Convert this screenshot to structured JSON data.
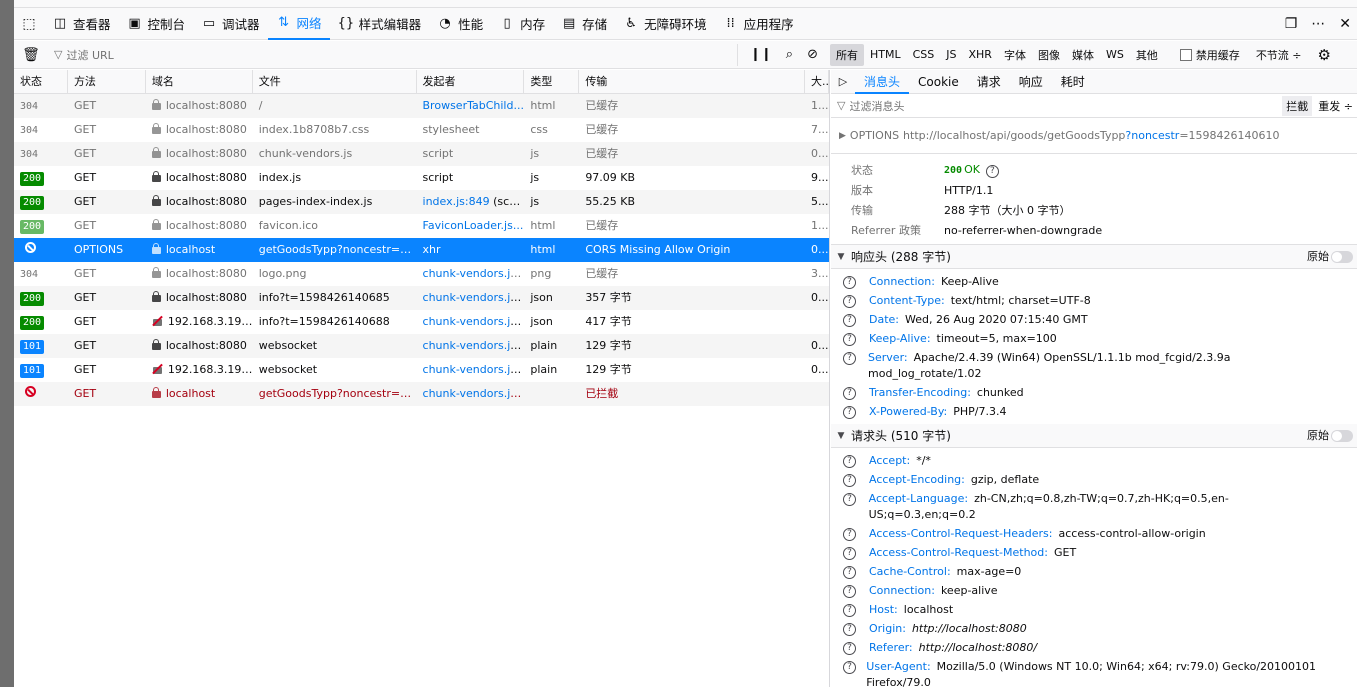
{
  "toolbar": {
    "tabs": [
      {
        "label": "查看器",
        "icon": "inspector-icon"
      },
      {
        "label": "控制台",
        "icon": "console-icon"
      },
      {
        "label": "调试器",
        "icon": "debugger-icon"
      },
      {
        "label": "网络",
        "icon": "network-icon"
      },
      {
        "label": "样式编辑器",
        "icon": "style-editor-icon"
      },
      {
        "label": "性能",
        "icon": "performance-icon"
      },
      {
        "label": "内存",
        "icon": "memory-icon"
      },
      {
        "label": "存储",
        "icon": "storage-icon"
      },
      {
        "label": "无障碍环境",
        "icon": "accessibility-icon"
      },
      {
        "label": "应用程序",
        "icon": "application-icon"
      }
    ],
    "active_tab": "网络"
  },
  "filterbar": {
    "placeholder": "过滤 URL",
    "types": [
      "所有",
      "HTML",
      "CSS",
      "JS",
      "XHR",
      "字体",
      "图像",
      "媒体",
      "WS",
      "其他"
    ],
    "selected_type": "所有",
    "disable_cache_label": "禁用缓存",
    "throttle_label": "不节流 ÷"
  },
  "table": {
    "columns": [
      "状态",
      "方法",
      "域名",
      "文件",
      "发起者",
      "类型",
      "传输",
      "大..."
    ],
    "rows": [
      {
        "status": "304",
        "method": "GET",
        "domain": "localhost:8080",
        "lock": "secure",
        "file": "/",
        "initiator": "BrowserTabChild...",
        "initiator_link": true,
        "type": "html",
        "transferred": "已缓存",
        "size": "1...",
        "style": "cached"
      },
      {
        "status": "304",
        "method": "GET",
        "domain": "localhost:8080",
        "lock": "secure",
        "file": "index.1b8708b7.css",
        "initiator": "stylesheet",
        "initiator_link": false,
        "type": "css",
        "transferred": "已缓存",
        "size": "7...",
        "style": "cached"
      },
      {
        "status": "304",
        "method": "GET",
        "domain": "localhost:8080",
        "lock": "secure",
        "file": "chunk-vendors.js",
        "initiator": "script",
        "initiator_link": false,
        "type": "js",
        "transferred": "已缓存",
        "size": "0...",
        "style": "cached"
      },
      {
        "status": "200",
        "method": "GET",
        "domain": "localhost:8080",
        "lock": "secure",
        "file": "index.js",
        "initiator": "script",
        "initiator_link": false,
        "type": "js",
        "transferred": "97.09 KB",
        "size": "9...",
        "style": "normal"
      },
      {
        "status": "200",
        "method": "GET",
        "domain": "localhost:8080",
        "lock": "secure",
        "file": "pages-index-index.js",
        "initiator": "index.js:849",
        "initiator_suffix": " (script)",
        "initiator_link": true,
        "type": "js",
        "transferred": "55.25 KB",
        "size": "5...",
        "style": "normal"
      },
      {
        "status": "200",
        "method": "GET",
        "domain": "localhost:8080",
        "lock": "secure",
        "file": "favicon.ico",
        "initiator": "FaviconLoader.js...",
        "initiator_link": true,
        "type": "html",
        "transferred": "已缓存",
        "size": "1...",
        "style": "cached"
      },
      {
        "status": "blocked",
        "method": "OPTIONS",
        "domain": "localhost",
        "lock": "secure",
        "file": "getGoodsTypp?noncestr=1...",
        "initiator": "xhr",
        "initiator_link": false,
        "type": "html",
        "transferred": "CORS Missing Allow Origin",
        "size": "0...",
        "style": "selected"
      },
      {
        "status": "304",
        "method": "GET",
        "domain": "localhost:8080",
        "lock": "secure",
        "file": "logo.png",
        "initiator": "chunk-vendors.js...",
        "initiator_link": true,
        "type": "png",
        "transferred": "已缓存",
        "size": "3...",
        "style": "cached"
      },
      {
        "status": "200",
        "method": "GET",
        "domain": "localhost:8080",
        "lock": "secure",
        "file": "info?t=1598426140685",
        "initiator": "chunk-vendors.js...",
        "initiator_link": true,
        "type": "json",
        "transferred": "357 字节",
        "size": "0...",
        "style": "normal"
      },
      {
        "status": "200",
        "method": "GET",
        "domain": "192.168.3.193:...",
        "lock": "insecure",
        "file": "info?t=1598426140688",
        "initiator": "chunk-vendors.js...",
        "initiator_link": true,
        "type": "json",
        "transferred": "417 字节",
        "size": "",
        "style": "normal"
      },
      {
        "status": "101",
        "method": "GET",
        "domain": "localhost:8080",
        "lock": "secure",
        "file": "websocket",
        "initiator": "chunk-vendors.js...",
        "initiator_link": true,
        "type": "plain",
        "transferred": "129 字节",
        "size": "0...",
        "style": "normal"
      },
      {
        "status": "101",
        "method": "GET",
        "domain": "192.168.3.193:...",
        "lock": "insecure",
        "file": "websocket",
        "initiator": "chunk-vendors.js...",
        "initiator_link": true,
        "type": "plain",
        "transferred": "129 字节",
        "size": "0...",
        "style": "normal"
      },
      {
        "status": "blocked",
        "method": "GET",
        "domain": "localhost",
        "lock": "secure",
        "file": "getGoodsTypp?noncestr=1...",
        "initiator": "chunk-vendors.js...",
        "initiator_link": true,
        "type": "",
        "transferred": "已拦截",
        "size": "",
        "style": "blocked"
      }
    ]
  },
  "panel": {
    "tabs": [
      "消息头",
      "Cookie",
      "请求",
      "响应",
      "耗时"
    ],
    "active_tab": "消息头",
    "filter_placeholder": "过滤消息头",
    "block_label": "拦截",
    "resend_label": "重发 ÷",
    "method": "OPTIONS",
    "url_base": "http://localhost/api/goods/getGoodsTypp",
    "url_query_key": "?noncestr",
    "url_query_value": "=1598426140610",
    "summary": {
      "status_label": "状态",
      "status_code": "200",
      "status_text": "OK",
      "version_label": "版本",
      "version": "HTTP/1.1",
      "transfer_label": "传输",
      "transfer": "288 字节（大小 0 字节）",
      "referrer_label": "Referrer 政策",
      "referrer": "no-referrer-when-downgrade"
    },
    "response_headers_title": "响应头 (288 字节)",
    "request_headers_title": "请求头 (510 字节)",
    "raw_label": "原始",
    "response_headers": [
      {
        "k": "Connection:",
        "v": "Keep-Alive"
      },
      {
        "k": "Content-Type:",
        "v": "text/html; charset=UTF-8"
      },
      {
        "k": "Date:",
        "v": "Wed, 26 Aug 2020 07:15:40 GMT"
      },
      {
        "k": "Keep-Alive:",
        "v": "timeout=5, max=100"
      },
      {
        "k": "Server:",
        "v": "Apache/2.4.39 (Win64) OpenSSL/1.1.1b mod_fcgid/2.3.9a mod_log_rotate/1.02"
      },
      {
        "k": "Transfer-Encoding:",
        "v": "chunked"
      },
      {
        "k": "X-Powered-By:",
        "v": "PHP/7.3.4"
      }
    ],
    "request_headers": [
      {
        "k": "Accept:",
        "v": "*/*"
      },
      {
        "k": "Accept-Encoding:",
        "v": "gzip, deflate"
      },
      {
        "k": "Accept-Language:",
        "v": "zh-CN,zh;q=0.8,zh-TW;q=0.7,zh-HK;q=0.5,en-US;q=0.3,en;q=0.2"
      },
      {
        "k": "Access-Control-Request-Headers:",
        "v": "access-control-allow-origin"
      },
      {
        "k": "Access-Control-Request-Method:",
        "v": "GET"
      },
      {
        "k": "Cache-Control:",
        "v": "max-age=0"
      },
      {
        "k": "Connection:",
        "v": "keep-alive"
      },
      {
        "k": "Host:",
        "v": "localhost"
      },
      {
        "k": "Origin:",
        "v": "http://localhost:8080",
        "italic": true
      },
      {
        "k": "Referer:",
        "v": "http://localhost:8080/",
        "italic": true
      },
      {
        "k": "User-Agent:",
        "v": "Mozilla/5.0 (Windows NT 10.0; Win64; x64; rv:79.0) Gecko/20100101 Firefox/79.0"
      }
    ]
  }
}
